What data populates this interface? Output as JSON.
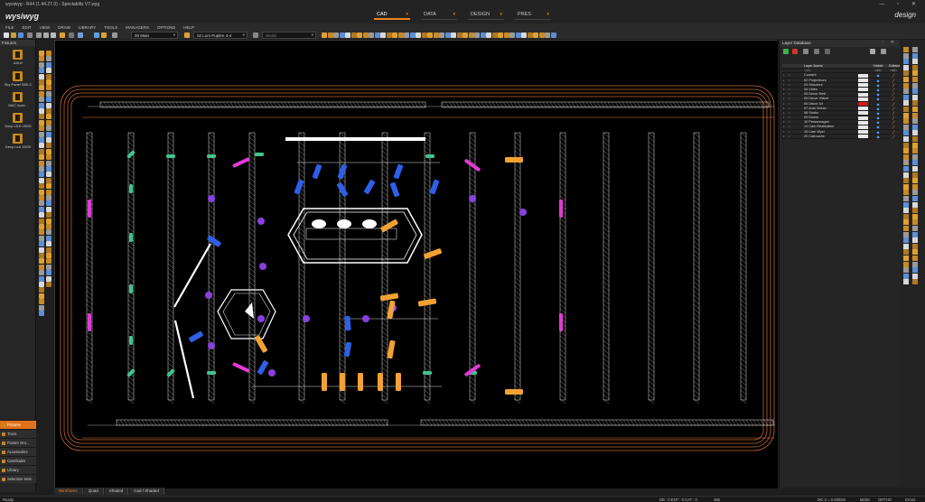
{
  "window": {
    "title": "wysiwyg - R44 (1.44.27.0) - Spectabilis V7.wyg",
    "controls": "— ▫ ✕"
  },
  "brand": {
    "logo": "wysiwyg",
    "mode_right": "design"
  },
  "modes": [
    {
      "label": "CAD",
      "active": true
    },
    {
      "label": "DATA",
      "active": false
    },
    {
      "label": "DESIGN",
      "active": false
    },
    {
      "label": "PRES",
      "active": false
    }
  ],
  "menu": [
    "FILE",
    "EDIT",
    "VIEW",
    "DRAW",
    "LIBRARY",
    "TOOLS",
    "MANAGERS",
    "OPTIONS",
    "HELP"
  ],
  "toolbar": {
    "scene_combo": "00 Main",
    "layer_combo": "02 Lum Pupitre 4-4",
    "style_combo": "World"
  },
  "fixtures_panel": {
    "title": "Fixtures",
    "items": [
      {
        "label": "AXLE"
      },
      {
        "label": "Sky Panel S60-C"
      },
      {
        "label": "MAC Aura..."
      },
      {
        "label": "Decp LED 25/50"
      },
      {
        "label": "Decp Led 15/30"
      }
    ]
  },
  "library_tabs": [
    {
      "label": "Fixtures",
      "active": true
    },
    {
      "label": "Truss",
      "active": false
    },
    {
      "label": "Fixture Gro...",
      "active": false
    },
    {
      "label": "Accessories",
      "active": false
    },
    {
      "label": "Cost/Sales",
      "active": false
    },
    {
      "label": "Library",
      "active": false
    },
    {
      "label": "Selection Sets",
      "active": false
    }
  ],
  "view_tabs": [
    {
      "label": "Wireframe",
      "active": true
    },
    {
      "label": "Quad",
      "active": false
    },
    {
      "label": "Shaded",
      "active": false
    },
    {
      "label": "Cad / Shaded",
      "active": false
    }
  ],
  "layer_panel": {
    "title": "Layer Database",
    "headers": {
      "name": "Layer Name",
      "visible": "Visible",
      "editable": "Editable"
    },
    "filter": "<all>",
    "layers": [
      {
        "name": "Courant",
        "color": "#e8e8e8"
      },
      {
        "name": "02 Projecteurs",
        "color": "#e8e8e8"
      },
      {
        "name": "03 Structure",
        "color": "#e8e8e8"
      },
      {
        "name": "04 Vidéo",
        "color": "#e8e8e8"
      },
      {
        "name": "05 Décor Réel",
        "color": "#e8e8e8"
      },
      {
        "name": "05 Décor Virtuel",
        "color": "#e8e8e8"
      },
      {
        "name": "06 Décor 3d",
        "color": "#d01c1c"
      },
      {
        "name": "07 Auto Virtuel",
        "color": "#e8e8e8"
      },
      {
        "name": "08 Studio",
        "color": "#e8e8e8"
      },
      {
        "name": "09 Divers",
        "color": "#e8e8e8"
      },
      {
        "name": "10 Personnages",
        "color": "#e8e8e8"
      },
      {
        "name": "14 Cam Réalisateur",
        "color": "#e8e8e8"
      },
      {
        "name": "15 Cam Wysi",
        "color": "#e8e8e8"
      },
      {
        "name": "20 Cartouche",
        "color": "#e8e8e8"
      }
    ]
  },
  "status": {
    "left": "Ready",
    "mid": "DB : 0  ENT : 0  CAT : 0",
    "mid2": "485",
    "scale": "MC 2 = 0.0000m",
    "units": "Metric",
    "ortho": "ORTHO",
    "snap": "Errors"
  },
  "colors": {
    "accent": "#f08020",
    "truss": "#e0e0e0",
    "led_green": "#3fc48f",
    "magenta": "#e23ad6",
    "purple": "#8a3fe0",
    "blue": "#2f5fe8",
    "amber": "#f2a233",
    "border_orange": "#e0783a"
  },
  "icons": [
    "save-icon",
    "open-icon",
    "undo-icon",
    "redo-icon",
    "pan-icon",
    "zoom-icon",
    "layer-icon",
    "eye-icon",
    "pencil-icon"
  ]
}
